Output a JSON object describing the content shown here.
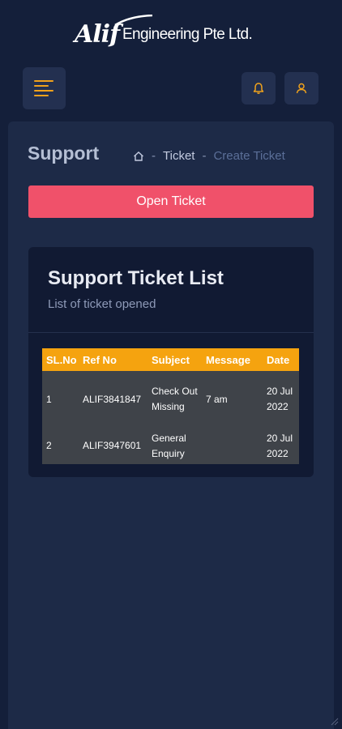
{
  "header": {
    "logo_mark": "Alif",
    "company_name": "Engineering Pte Ltd."
  },
  "page": {
    "title": "Support",
    "breadcrumb": {
      "home_icon": "home-icon",
      "separator": "-",
      "items": [
        "Ticket",
        "Create Ticket"
      ]
    },
    "open_ticket_label": "Open Ticket"
  },
  "card": {
    "title": "Support Ticket List",
    "subtitle": "List of ticket opened"
  },
  "table": {
    "columns": [
      "SL.No",
      "Ref No",
      "Subject",
      "Message",
      "Date"
    ],
    "rows": [
      {
        "sl": "1",
        "ref": "ALIF3841847",
        "subject": "Check Out Missing",
        "message": "7 am",
        "date": "20 Jul 2022"
      },
      {
        "sl": "2",
        "ref": "ALIF3947601",
        "subject": "General Enquiry",
        "message": "",
        "date": "20 Jul 2022"
      }
    ]
  },
  "colors": {
    "background": "#141f3a",
    "panel": "#1d2a47",
    "card": "#111a33",
    "accent": "#f0a21c",
    "button": "#f0516a",
    "table_header": "#f5a30f",
    "table_row": "#3f4349"
  },
  "icons": {
    "menu": "hamburger-menu-icon",
    "notifications": "bell-icon",
    "account": "user-icon"
  }
}
